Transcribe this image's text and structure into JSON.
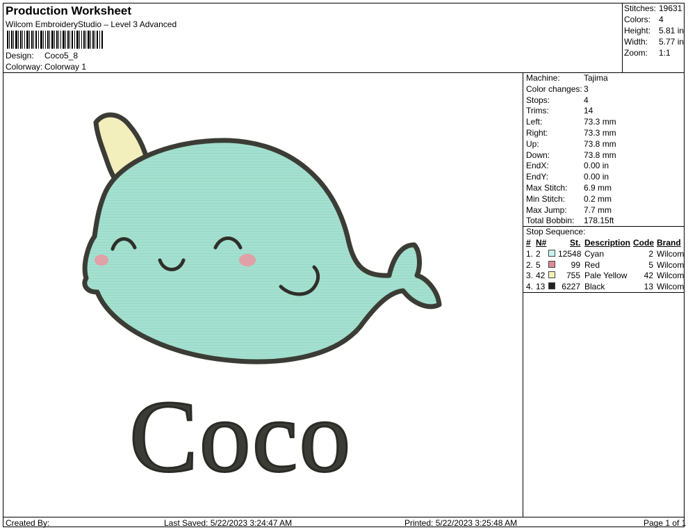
{
  "header": {
    "title": "Production Worksheet",
    "software": "Wilcom EmbroideryStudio – Level 3 Advanced",
    "design_label": "Design:",
    "design_value": "Coco5_8",
    "colorway_label": "Colorway:",
    "colorway_value": "Colorway 1"
  },
  "summary": [
    {
      "label": "Stitches:",
      "value": "19631"
    },
    {
      "label": "Colors:",
      "value": "4"
    },
    {
      "label": "Height:",
      "value": "5.81 in"
    },
    {
      "label": "Width:",
      "value": "5.77 in"
    },
    {
      "label": "Zoom:",
      "value": "1:1"
    }
  ],
  "specs": [
    {
      "label": "Machine:",
      "value": "Tajima"
    },
    {
      "label": "Color changes:",
      "value": "3"
    },
    {
      "label": "Stops:",
      "value": "4"
    },
    {
      "label": "Trims:",
      "value": "14"
    },
    {
      "label": "Left:",
      "value": "73.3 mm"
    },
    {
      "label": "Right:",
      "value": "73.3 mm"
    },
    {
      "label": "Up:",
      "value": "73.8 mm"
    },
    {
      "label": "Down:",
      "value": "73.8 mm"
    },
    {
      "label": "EndX:",
      "value": "0.00 in"
    },
    {
      "label": "EndY:",
      "value": "0.00 in"
    },
    {
      "label": "Max Stitch:",
      "value": "6.9 mm"
    },
    {
      "label": "Min Stitch:",
      "value": "0.2 mm"
    },
    {
      "label": "Max Jump:",
      "value": "7.7 mm"
    },
    {
      "label": "Total Bobbin:",
      "value": "178.15ft"
    }
  ],
  "stop_sequence": {
    "title": "Stop Sequence:",
    "headers": {
      "num": "#",
      "n": "N#",
      "st": "St.",
      "desc": "Description",
      "code": "Code",
      "brand": "Brand"
    },
    "rows": [
      {
        "num": "1.",
        "n": "2",
        "color": "#c8f4f0",
        "st": "12548",
        "desc": "Cyan",
        "code": "2",
        "brand": "Wilcom"
      },
      {
        "num": "2.",
        "n": "5",
        "color": "#e08a98",
        "st": "99",
        "desc": "Red",
        "code": "5",
        "brand": "Wilcom"
      },
      {
        "num": "3.",
        "n": "42",
        "color": "#f4f0b8",
        "st": "755",
        "desc": "Pale Yellow",
        "code": "42",
        "brand": "Wilcom"
      },
      {
        "num": "4.",
        "n": "13",
        "color": "#222222",
        "st": "6227",
        "desc": "Black",
        "code": "13",
        "brand": "Wilcom"
      }
    ]
  },
  "design": {
    "text": "Coco"
  },
  "footer": {
    "created_by": "Created By:",
    "last_saved": "Last Saved: 5/22/2023 3:24:47 AM",
    "printed": "Printed: 5/22/2023 3:25:48 AM",
    "page": "Page 1 of 1"
  }
}
